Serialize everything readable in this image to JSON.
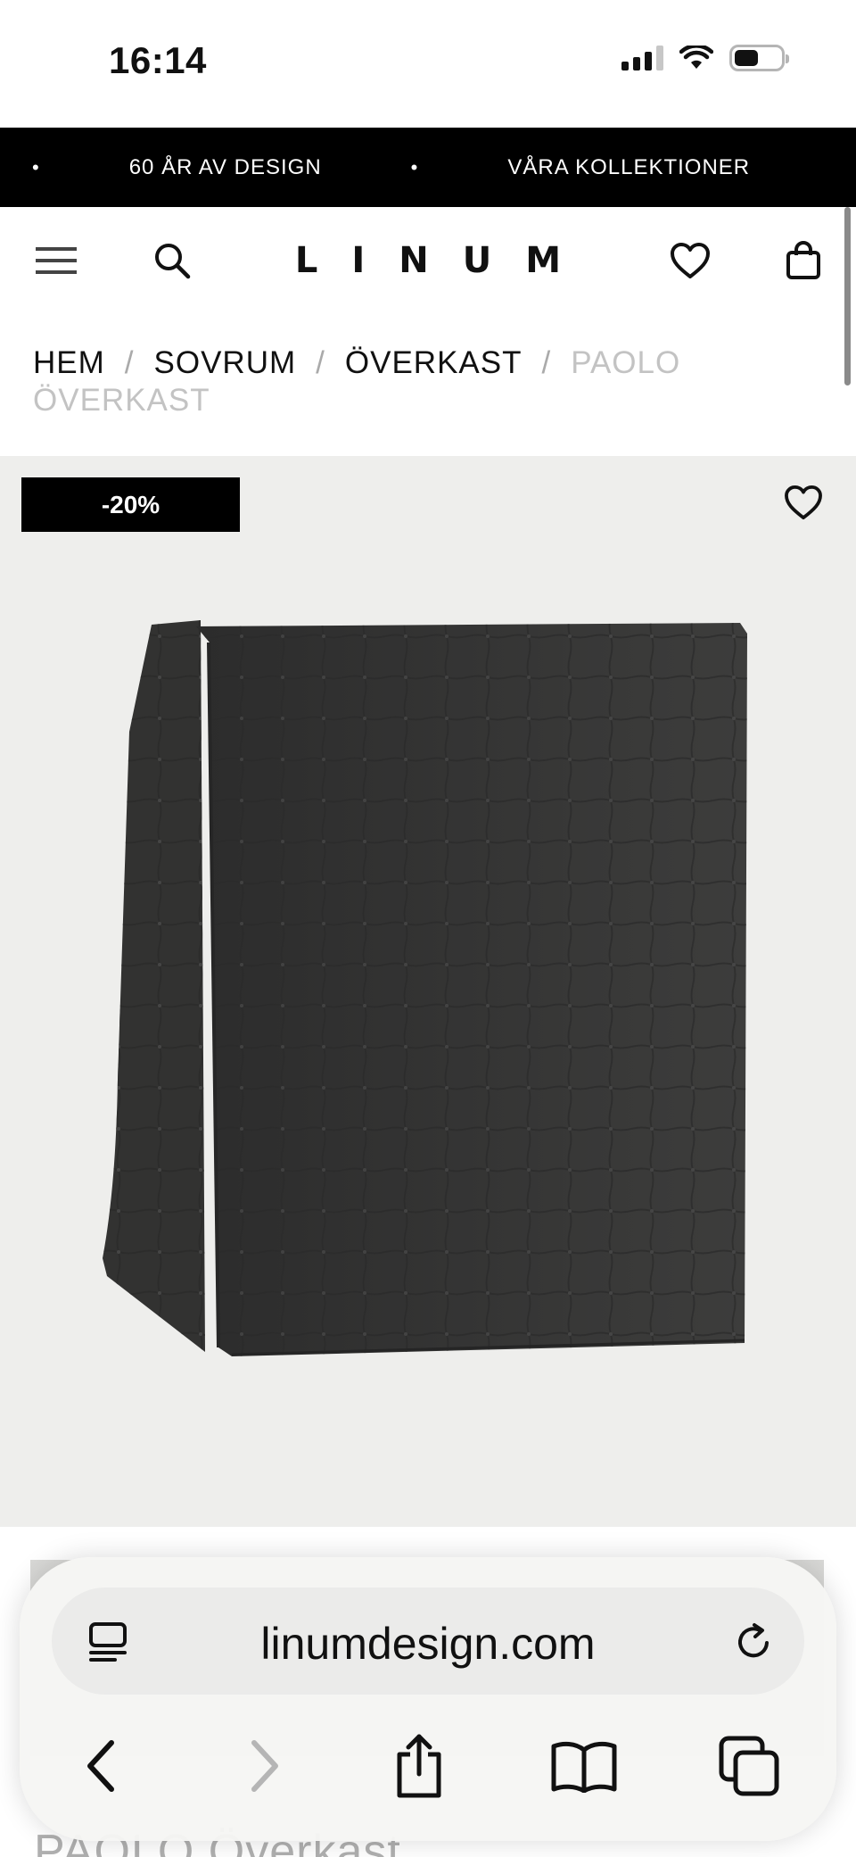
{
  "status_bar": {
    "time": "16:14"
  },
  "ticker": {
    "items": [
      "60 ÅR AV DESIGN",
      "VÅRA KOLLEKTIONER"
    ]
  },
  "header": {
    "logo": "LINUM",
    "icons": [
      "menu-icon",
      "search-icon",
      "heart-icon",
      "bag-icon"
    ]
  },
  "breadcrumb": {
    "items": [
      "HEM",
      "SOVRUM",
      "ÖVERKAST"
    ],
    "current": "PAOLO ÖVERKAST",
    "separator": "/"
  },
  "product": {
    "discount_badge": "-20%",
    "title_peek": "PAOLO Överkast",
    "image_subject": "dark grey quilted bedspread folded"
  },
  "browser": {
    "url": "linumdesign.com",
    "toolbar_icons": [
      "back-icon",
      "forward-icon",
      "share-icon",
      "bookmarks-icon",
      "tabs-icon"
    ]
  },
  "colors": {
    "ticker_bg": "#000000",
    "product_bg": "#eeeeec",
    "badge_bg": "#000000",
    "breadcrumb_current": "#c3c3c3"
  }
}
